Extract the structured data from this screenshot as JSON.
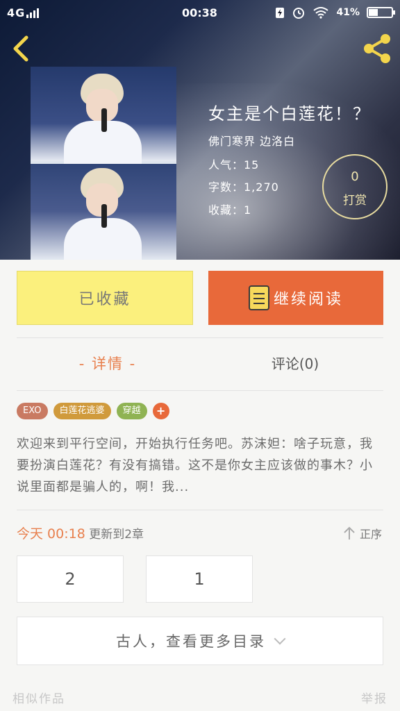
{
  "status_bar": {
    "network": "4G",
    "time": "00:38",
    "battery_text": "41%",
    "battery_level": 0.41,
    "icons": [
      "signal-icon",
      "charging-icon",
      "alarm-icon",
      "wifi-icon",
      "battery-icon"
    ]
  },
  "header": {
    "back_icon": "chevron-left-icon",
    "share_icon": "share-icon"
  },
  "book": {
    "title": "女主是个白莲花！？",
    "author": "佛门寒界 边洛白",
    "popularity": "人气：15",
    "word_count": "字数：1,270",
    "favorites": "收藏：1",
    "tip_count": "0",
    "tip_label": "打赏"
  },
  "actions": {
    "collected_label": "已收藏",
    "continue_reading_label": "继续阅读"
  },
  "tabs": {
    "detail": "- 详情 -",
    "comments": "评论(0)"
  },
  "tags": [
    {
      "label": "EXO",
      "color": "#c97a62"
    },
    {
      "label": "白莲花逃婆",
      "color": "#d09a3c"
    },
    {
      "label": "穿越",
      "color": "#8fb353"
    }
  ],
  "synopsis": "欢迎来到平行空间，开始执行任务吧。苏沫妲：啥子玩意，我要扮演白莲花？有没有搞错。这不是你女主应该做的事木？小说里面都是骗人的，啊！我...",
  "update": {
    "today_time": "今天 00:18",
    "text": "更新到2章",
    "sort_label": "正序"
  },
  "chapters": [
    "2",
    "1"
  ],
  "more_catalog_label": "古人，查看更多目录",
  "footer": {
    "similar": "相似作品",
    "report": "举报"
  },
  "colors": {
    "accent_orange": "#e8693a",
    "collected_yellow": "#fbf07d"
  }
}
